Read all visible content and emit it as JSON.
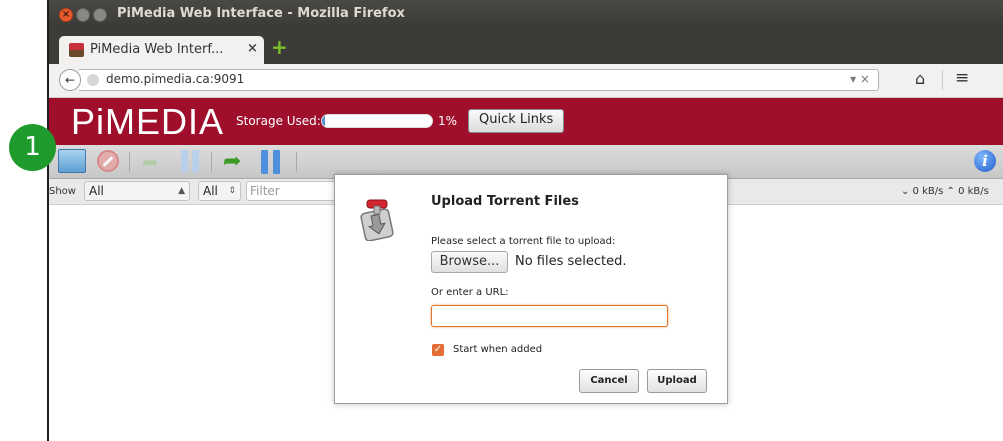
{
  "window": {
    "title": "PiMedia Web Interface - Mozilla Firefox",
    "close_glyph": "×"
  },
  "tab": {
    "label": "PiMedia Web Interf...",
    "close": "×",
    "new_tab": "+"
  },
  "navbar": {
    "back": "←",
    "url": "demo.pimedia.ca:9091",
    "url_controls": "▾ ×",
    "home": "⌂",
    "menu": "≡"
  },
  "header": {
    "logo": "PiMEDIA",
    "storage_label": "Storage Used:",
    "storage_percent": "1%",
    "storage_fraction": 0.01,
    "quick_links": "Quick Links"
  },
  "toolbar": {
    "info": "i"
  },
  "filterbar": {
    "show_label": "Show",
    "filter1": "All",
    "filter2": "All",
    "filter_placeholder": "Filter",
    "speed": "⌄ 0 kB/s  ⌃ 0 kB/s"
  },
  "dialog": {
    "title": "Upload Torrent Files",
    "select_msg": "Please select a torrent file to upload:",
    "browse": "Browse...",
    "no_file": "No files selected.",
    "url_label": "Or enter a URL:",
    "url_value": "",
    "start_checked": true,
    "start_label": "Start when added",
    "cancel": "Cancel",
    "upload": "Upload"
  },
  "annotation": {
    "badge": "1"
  },
  "colors": {
    "brand": "#9f0f2c",
    "accent": "#e46d36",
    "badge": "#1f9b2d"
  }
}
